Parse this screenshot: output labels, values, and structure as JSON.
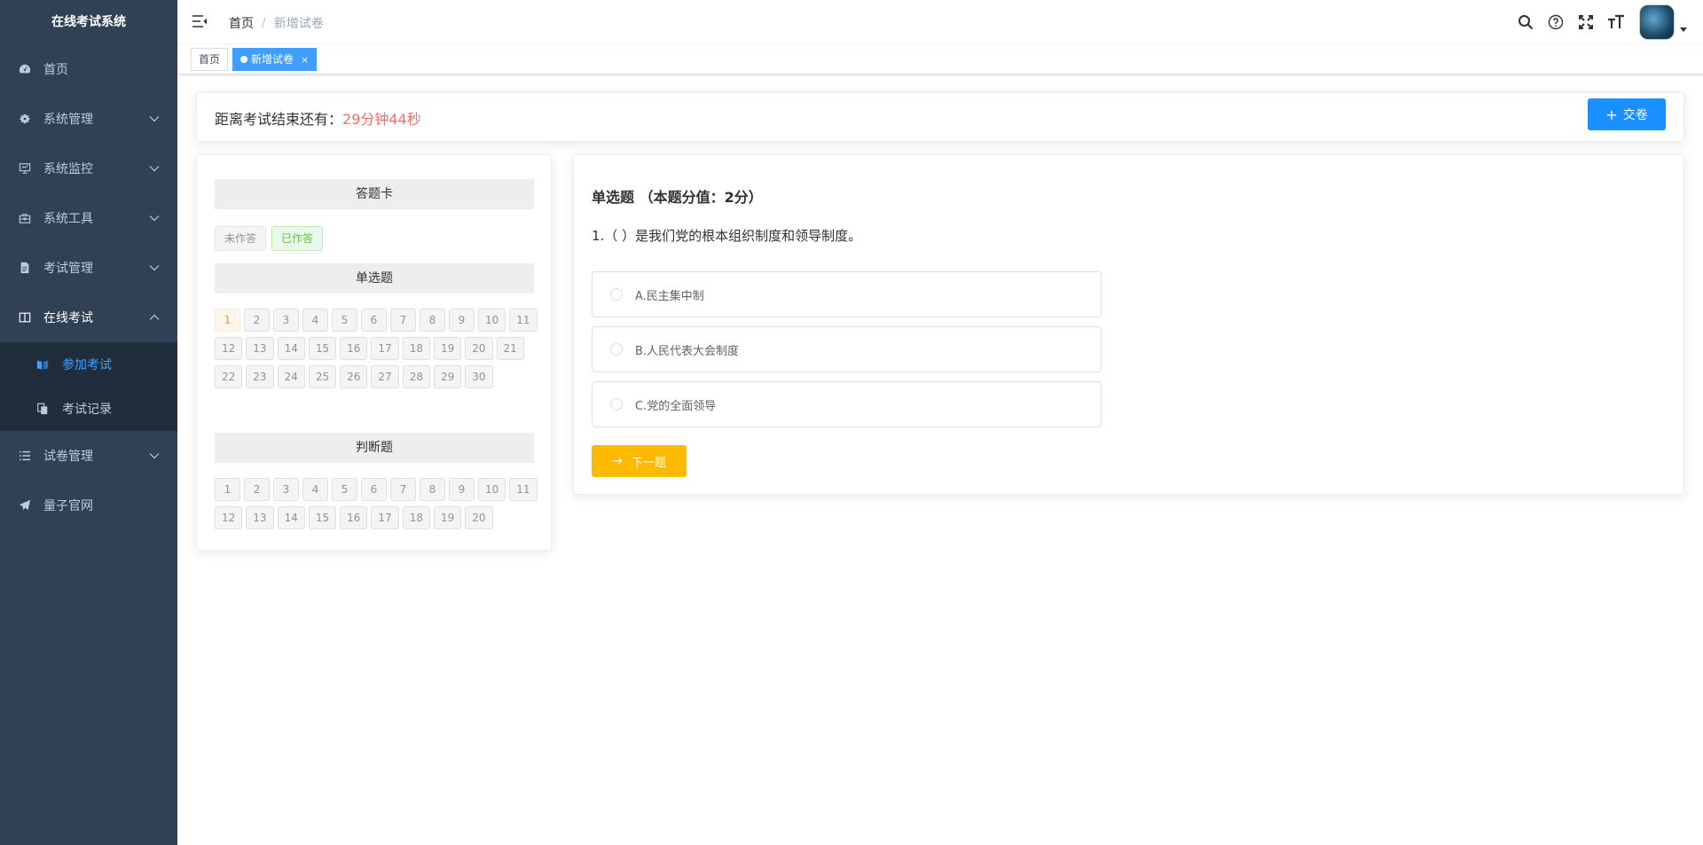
{
  "sidebar": {
    "title": "在线考试系统",
    "items": [
      {
        "label": "首页",
        "icon": "dashboard-icon"
      },
      {
        "label": "系统管理",
        "icon": "system-gear-icon"
      },
      {
        "label": "系统监控",
        "icon": "monitor-icon"
      },
      {
        "label": "系统工具",
        "icon": "toolbox-icon"
      },
      {
        "label": "考试管理",
        "icon": "document-icon"
      },
      {
        "label": "在线考试",
        "icon": "book-icon"
      },
      {
        "label": "试卷管理",
        "icon": "list-icon"
      },
      {
        "label": "量子官网",
        "icon": "paper-plane-icon"
      }
    ],
    "submenu": [
      {
        "label": "参加考试",
        "icon": "open-book-icon"
      },
      {
        "label": "考试记录",
        "icon": "copy-icon"
      }
    ]
  },
  "navbar": {
    "breadcrumb_home": "首页",
    "breadcrumb_sep": "/",
    "breadcrumb_current": "新增试卷"
  },
  "tags": {
    "home": "首页",
    "active": "新增试卷",
    "close": "×"
  },
  "timer": {
    "label": "距离考试结束还有：",
    "remaining": "29分钟44秒",
    "submit": "交卷"
  },
  "answer_card": {
    "title": "答题卡",
    "legend_unanswered": "未作答",
    "legend_answered": "已作答",
    "single_title": "单选题",
    "single_numbers": [
      "1",
      "2",
      "3",
      "4",
      "5",
      "6",
      "7",
      "8",
      "9",
      "10",
      "11",
      "12",
      "13",
      "14",
      "15",
      "16",
      "17",
      "18",
      "19",
      "20",
      "21",
      "22",
      "23",
      "24",
      "25",
      "26",
      "27",
      "28",
      "29",
      "30"
    ],
    "judge_title": "判断题",
    "judge_numbers": [
      "1",
      "2",
      "3",
      "4",
      "5",
      "6",
      "7",
      "8",
      "9",
      "10",
      "11",
      "12",
      "13",
      "14",
      "15",
      "16",
      "17",
      "18",
      "19",
      "20"
    ]
  },
  "question": {
    "type": "单选题 （本题分值：2分）",
    "text": "1.（ ）是我们党的根本组织制度和领导制度。",
    "options": [
      "A.民主集中制",
      "B.人民代表大会制度",
      "C.党的全面领导"
    ],
    "next": "下一题"
  },
  "colors": {
    "sidebar_bg": "#304156",
    "accent": "#1890ff",
    "timer_red": "#f56c6c",
    "next_yellow": "#ffba00"
  }
}
